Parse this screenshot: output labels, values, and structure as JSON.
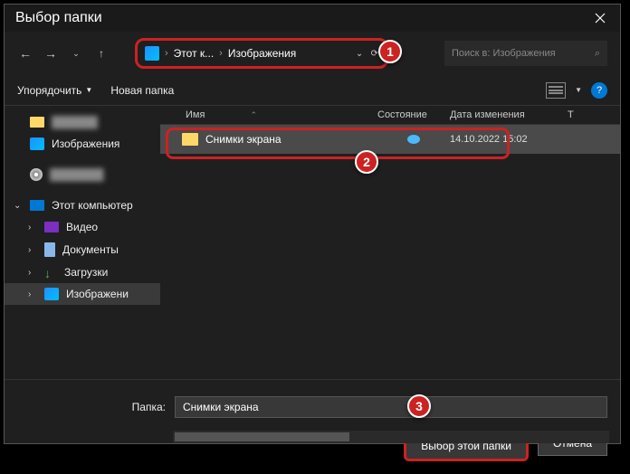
{
  "titlebar": {
    "title": "Выбор папки"
  },
  "nav": {
    "addr_part1": "Этот к...",
    "addr_part2": "Изображения",
    "search_placeholder": "Поиск в: Изображения"
  },
  "toolbar": {
    "organize": "Упорядочить",
    "new_folder": "Новая папка"
  },
  "sidebar": {
    "images": "Изображения",
    "this_pc": "Этот компьютер",
    "video": "Видео",
    "documents": "Документы",
    "downloads": "Загрузки",
    "images2": "Изображени"
  },
  "columns": {
    "name": "Имя",
    "state": "Состояние",
    "date": "Дата изменения",
    "type_initial": "Т"
  },
  "row": {
    "name": "Снимки экрана",
    "date": "14.10.2022 15:02"
  },
  "bottom": {
    "label": "Папка:",
    "value": "Снимки экрана",
    "select": "Выбор этой папки",
    "cancel": "Отмена"
  },
  "badges": {
    "1": "1",
    "2": "2",
    "3": "3"
  }
}
